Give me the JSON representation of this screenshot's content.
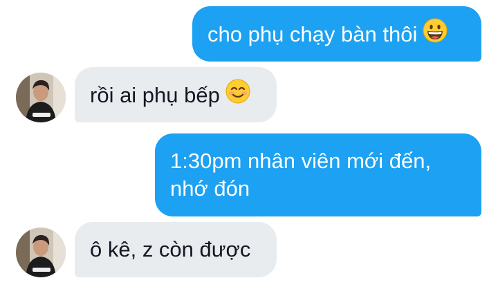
{
  "messages": [
    {
      "direction": "sent",
      "text": "cho phụ chạy bàn thôi",
      "emoji": "grinning-face"
    },
    {
      "direction": "received",
      "text": "rồi ai phụ bếp",
      "emoji": "smiling-face"
    },
    {
      "direction": "sent",
      "text": "1:30pm nhân viên mới đến, nhớ đón"
    },
    {
      "direction": "received",
      "text": "ô kê, z còn được"
    }
  ],
  "colors": {
    "sent_bubble": "#1da1f2",
    "received_bubble": "#e8ecef",
    "sent_text": "#ffffff",
    "received_text": "#141823",
    "emoji_face": "#ffcc33"
  }
}
